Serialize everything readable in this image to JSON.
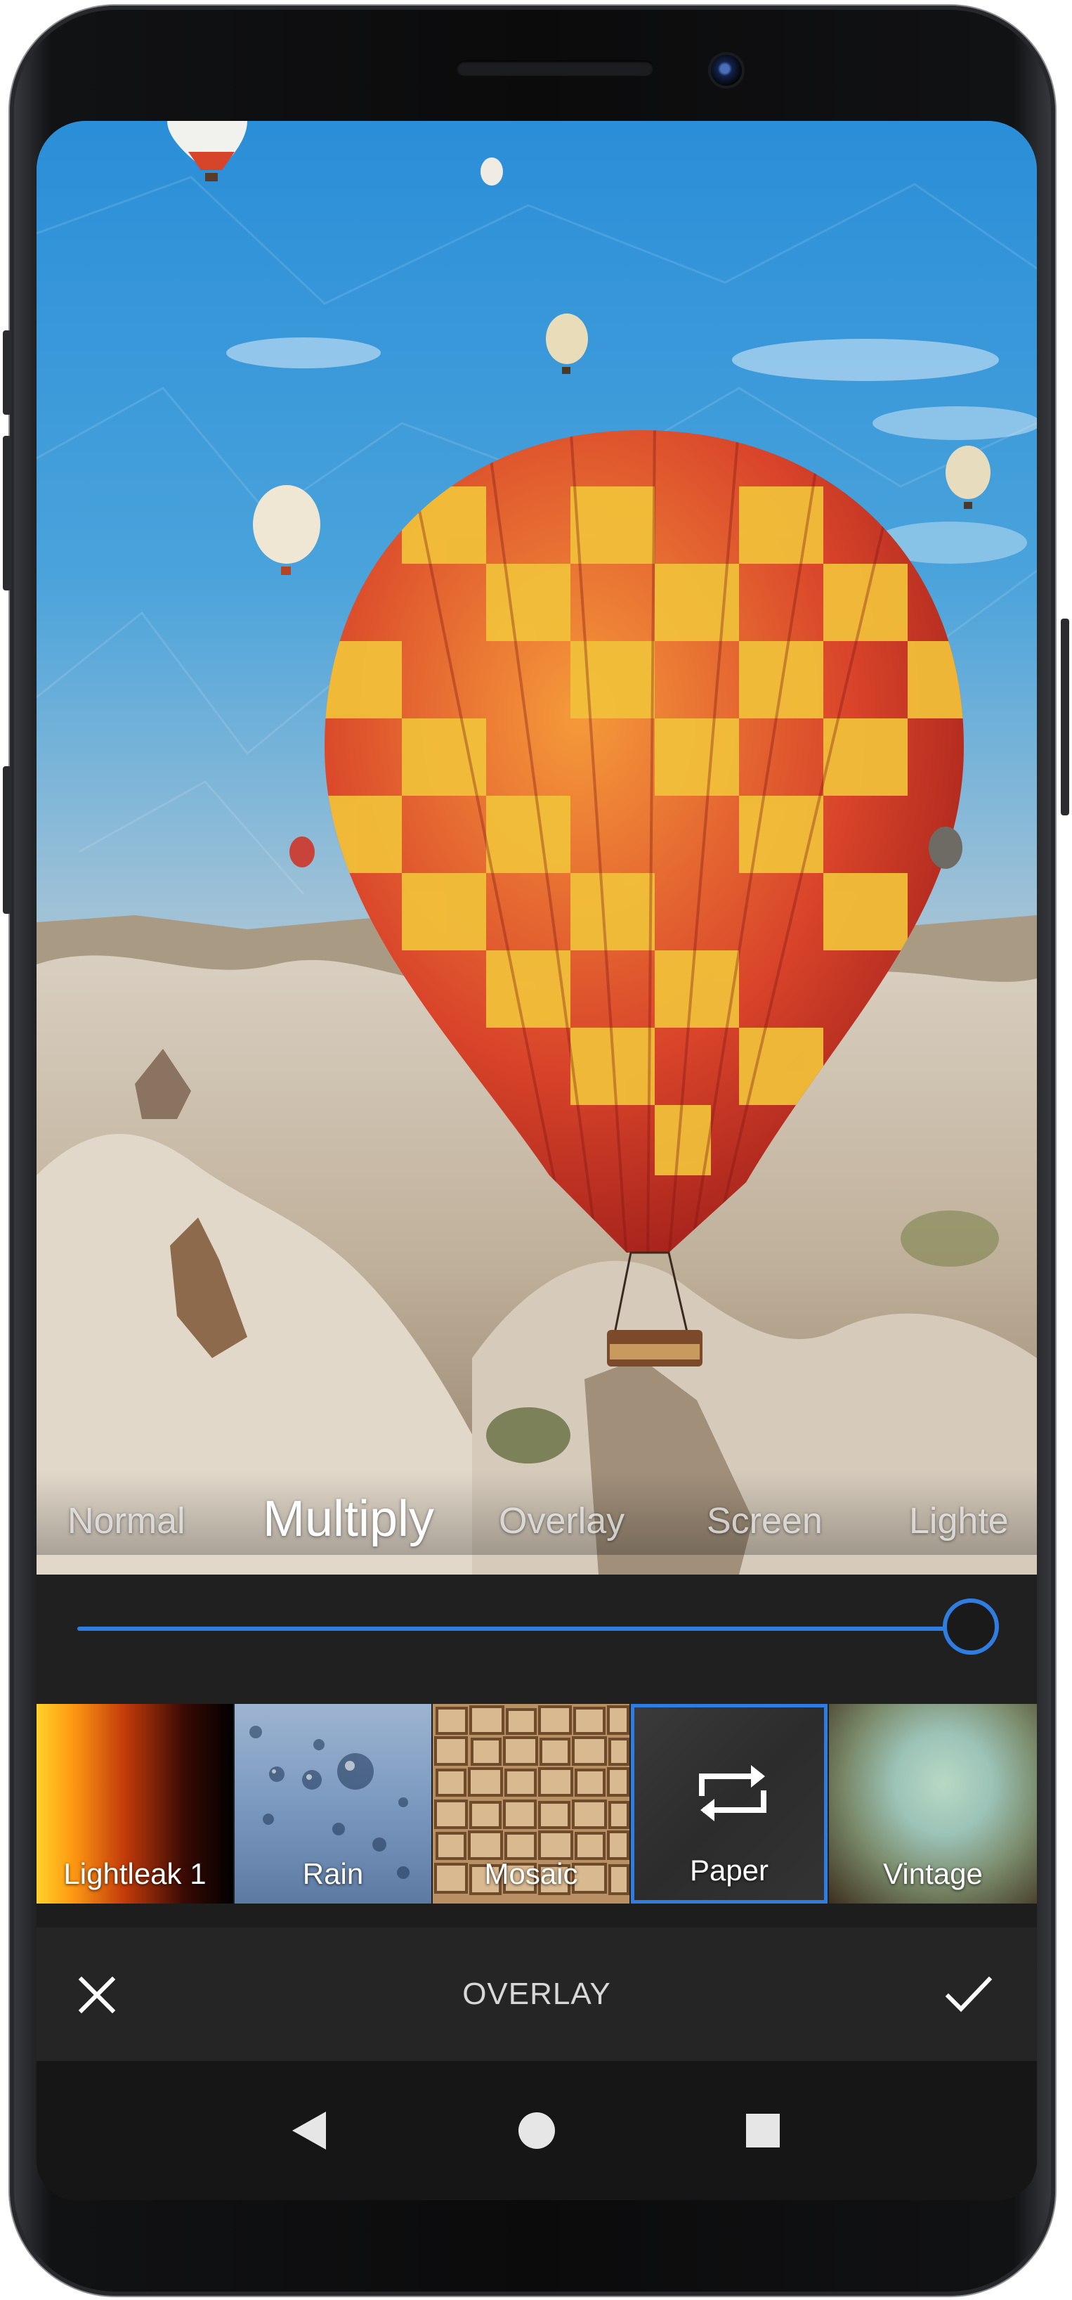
{
  "editor": {
    "blend_modes": [
      "Normal",
      "Multiply",
      "Overlay",
      "Screen",
      "Lighte"
    ],
    "selected_blend_mode": "Multiply",
    "slider_value": 1.0,
    "overlays": [
      {
        "label": "Lightleak 1",
        "icon": "none"
      },
      {
        "label": "Rain",
        "icon": "none"
      },
      {
        "label": "Mosaic",
        "icon": "none"
      },
      {
        "label": "Paper",
        "icon": "swap-icon",
        "selected": true
      },
      {
        "label": "Vintage",
        "icon": "none"
      }
    ],
    "toolbar": {
      "title": "OVERLAY",
      "cancel_icon": "close-icon",
      "confirm_icon": "check-icon"
    }
  },
  "navigation": {
    "back_icon": "back-triangle-icon",
    "home_icon": "home-circle-icon",
    "recents_icon": "recents-square-icon"
  },
  "colors": {
    "accent": "#2f7de1",
    "panel": "#202020",
    "bar": "#252525"
  }
}
